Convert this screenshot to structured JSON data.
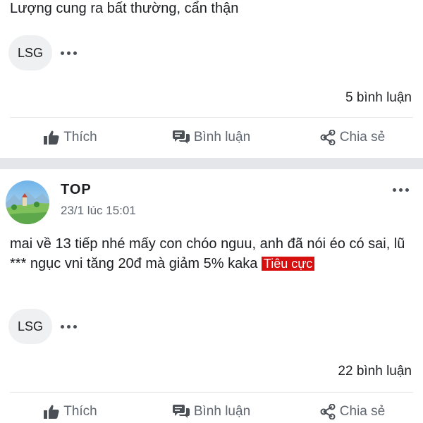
{
  "posts": [
    {
      "body": "Lượng cung ra bất thường, cẩn thận",
      "reactor": "LSG",
      "comments": "5 bình luận",
      "actions": {
        "like": "Thích",
        "comment": "Bình luận",
        "share": "Chia sẻ"
      }
    },
    {
      "author": "TOP",
      "timestamp": "23/1 lúc 15:01",
      "body": "mai về 13 tiếp nhé mấy con chóo nguu, anh đã nói éo có sai, lũ *** ngục vni tăng 20đ mà giảm 5% kaka",
      "tag": "Tiêu cực",
      "reactor": "LSG",
      "comments": "22 bình luận",
      "actions": {
        "like": "Thích",
        "comment": "Bình luận",
        "share": "Chia sẻ"
      }
    }
  ],
  "colors": {
    "tag_bg": "#d70f0f",
    "action_text": "#606770",
    "separator": "#e4e6e9"
  },
  "icons": {
    "like": "thumbs-up-icon",
    "comment": "comment-bubbles-icon",
    "share": "share-icon",
    "more": "more-dots-icon"
  }
}
